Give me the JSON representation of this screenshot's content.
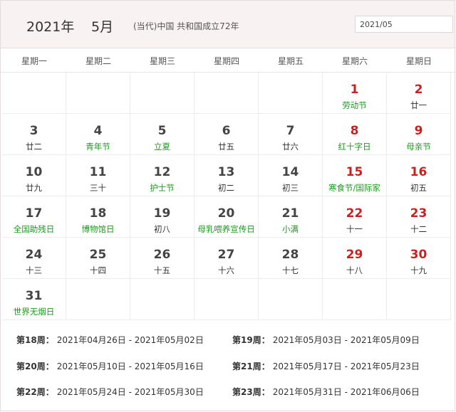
{
  "header": {
    "year": "2021年",
    "month": "5月",
    "info": "(当代)中国 共和国成立72年",
    "date_value": "2021/05"
  },
  "weekdays": [
    "星期一",
    "星期二",
    "星期三",
    "星期四",
    "星期五",
    "星期六",
    "星期日"
  ],
  "days": [
    {
      "num": "",
      "sub": "",
      "red": false,
      "green": false
    },
    {
      "num": "",
      "sub": "",
      "red": false,
      "green": false
    },
    {
      "num": "",
      "sub": "",
      "red": false,
      "green": false
    },
    {
      "num": "",
      "sub": "",
      "red": false,
      "green": false
    },
    {
      "num": "",
      "sub": "",
      "red": false,
      "green": false
    },
    {
      "num": "1",
      "sub": "劳动节",
      "red": true,
      "green": true
    },
    {
      "num": "2",
      "sub": "廿一",
      "red": true,
      "green": false
    },
    {
      "num": "3",
      "sub": "廿二",
      "red": false,
      "green": false
    },
    {
      "num": "4",
      "sub": "青年节",
      "red": false,
      "green": true
    },
    {
      "num": "5",
      "sub": "立夏",
      "red": false,
      "green": true
    },
    {
      "num": "6",
      "sub": "廿五",
      "red": false,
      "green": false
    },
    {
      "num": "7",
      "sub": "廿六",
      "red": false,
      "green": false
    },
    {
      "num": "8",
      "sub": "红十字日",
      "red": true,
      "green": true
    },
    {
      "num": "9",
      "sub": "母亲节",
      "red": true,
      "green": true
    },
    {
      "num": "10",
      "sub": "廿九",
      "red": false,
      "green": false
    },
    {
      "num": "11",
      "sub": "三十",
      "red": false,
      "green": false
    },
    {
      "num": "12",
      "sub": "护士节",
      "red": false,
      "green": true
    },
    {
      "num": "13",
      "sub": "初二",
      "red": false,
      "green": false
    },
    {
      "num": "14",
      "sub": "初三",
      "red": false,
      "green": false
    },
    {
      "num": "15",
      "sub": "寒食节/国际家",
      "red": true,
      "green": true
    },
    {
      "num": "16",
      "sub": "初五",
      "red": true,
      "green": false
    },
    {
      "num": "17",
      "sub": "全国助残日",
      "red": false,
      "green": true
    },
    {
      "num": "18",
      "sub": "博物馆日",
      "red": false,
      "green": true
    },
    {
      "num": "19",
      "sub": "初八",
      "red": false,
      "green": false
    },
    {
      "num": "20",
      "sub": "母乳喂养宣传日",
      "red": false,
      "green": true
    },
    {
      "num": "21",
      "sub": "小满",
      "red": false,
      "green": true
    },
    {
      "num": "22",
      "sub": "十一",
      "red": true,
      "green": false
    },
    {
      "num": "23",
      "sub": "十二",
      "red": true,
      "green": false
    },
    {
      "num": "24",
      "sub": "十三",
      "red": false,
      "green": false
    },
    {
      "num": "25",
      "sub": "十四",
      "red": false,
      "green": false
    },
    {
      "num": "26",
      "sub": "十五",
      "red": false,
      "green": false
    },
    {
      "num": "27",
      "sub": "十六",
      "red": false,
      "green": false
    },
    {
      "num": "28",
      "sub": "十七",
      "red": false,
      "green": false
    },
    {
      "num": "29",
      "sub": "十八",
      "red": true,
      "green": false
    },
    {
      "num": "30",
      "sub": "十九",
      "red": true,
      "green": false
    },
    {
      "num": "31",
      "sub": "世界无烟日",
      "red": false,
      "green": true
    },
    {
      "num": "",
      "sub": "",
      "red": false,
      "green": false
    },
    {
      "num": "",
      "sub": "",
      "red": false,
      "green": false
    },
    {
      "num": "",
      "sub": "",
      "red": false,
      "green": false
    },
    {
      "num": "",
      "sub": "",
      "red": false,
      "green": false
    },
    {
      "num": "",
      "sub": "",
      "red": false,
      "green": false
    },
    {
      "num": "",
      "sub": "",
      "red": false,
      "green": false
    }
  ],
  "weeks": [
    {
      "label": "第18周：",
      "range": "2021年04月26日 - 2021年05月02日"
    },
    {
      "label": "第19周：",
      "range": "2021年05月03日 - 2021年05月09日"
    },
    {
      "label": "第20周：",
      "range": "2021年05月10日 - 2021年05月16日"
    },
    {
      "label": "第21周：",
      "range": "2021年05月17日 - 2021年05月23日"
    },
    {
      "label": "第22周：",
      "range": "2021年05月24日 - 2021年05月30日"
    },
    {
      "label": "第23周：",
      "range": "2021年05月31日 - 2021年06月06日"
    }
  ],
  "colors": {
    "weekend_red": "#cc1f1f",
    "festival_green": "#1a9a1a",
    "header_bg": "#f8f2f2"
  }
}
